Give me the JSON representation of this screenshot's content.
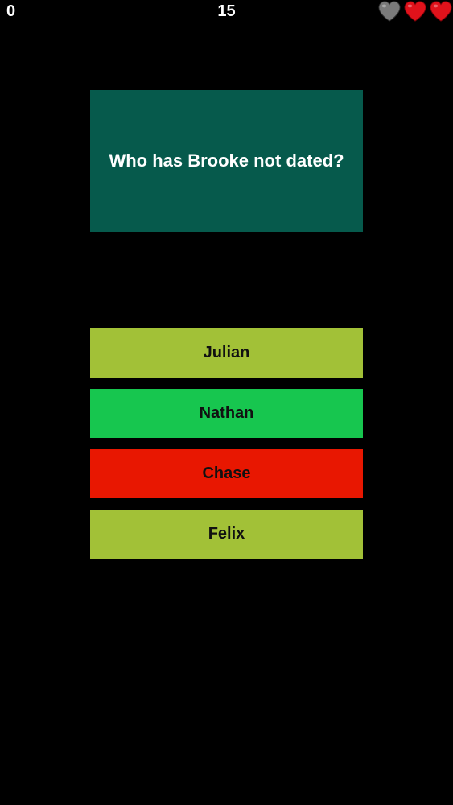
{
  "hud": {
    "score": "0",
    "timer": "15",
    "lives": [
      {
        "state": "lost",
        "icon": "heart-icon",
        "color": "#7a7a7a"
      },
      {
        "state": "active",
        "icon": "heart-icon",
        "color": "#e0121b"
      },
      {
        "state": "active",
        "icon": "heart-icon",
        "color": "#e0121b"
      }
    ]
  },
  "question": {
    "text": "Who has Brooke not dated?",
    "color": "#065a4c"
  },
  "answers": [
    {
      "label": "Julian",
      "color": "#a2c137",
      "state": "neutral"
    },
    {
      "label": "Nathan",
      "color": "#17c64f",
      "state": "correct"
    },
    {
      "label": "Chase",
      "color": "#e81701",
      "state": "wrong"
    },
    {
      "label": "Felix",
      "color": "#a2c137",
      "state": "neutral"
    }
  ]
}
